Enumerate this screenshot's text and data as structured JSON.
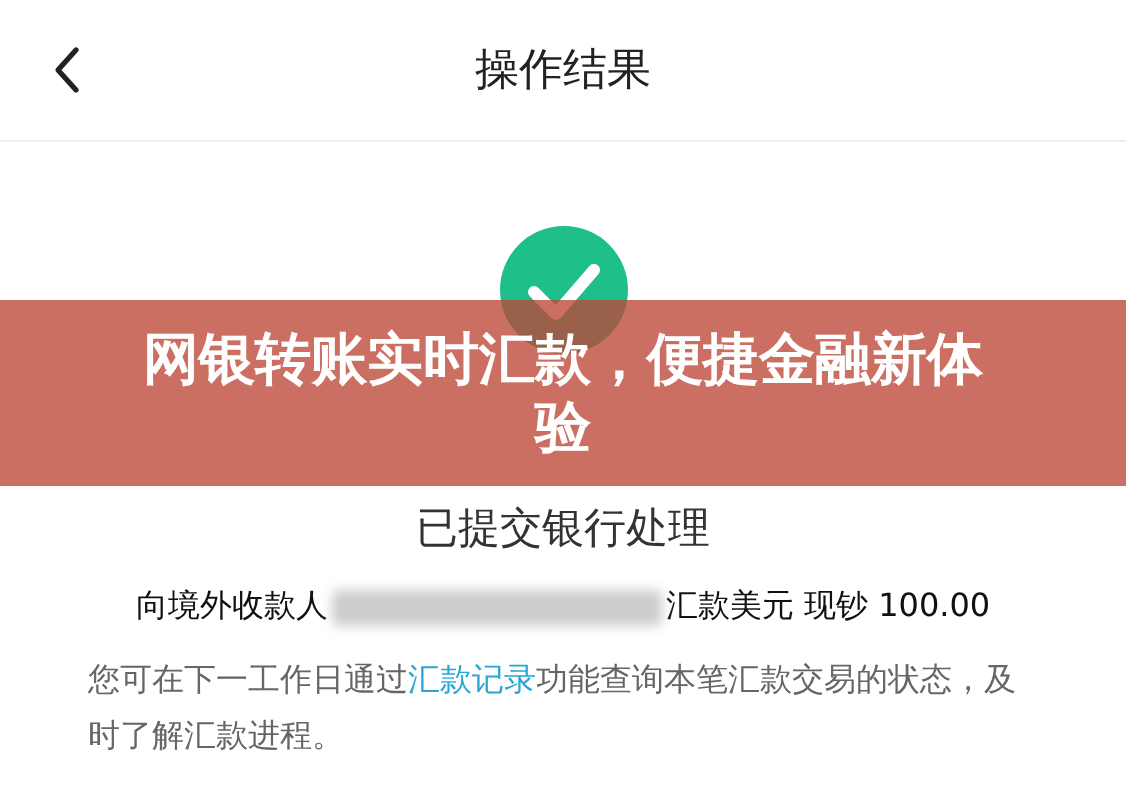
{
  "header": {
    "title": "操作结果"
  },
  "result": {
    "status": "已提交银行处理"
  },
  "summary": {
    "prefix": "向境外收款人",
    "amount": "汇款美元 现钞 100.00"
  },
  "note": {
    "before": "您可在下一工作日通过",
    "link": "汇款记录",
    "after": "功能查询本笔汇款交易的状态，及时了解汇款进程。"
  },
  "banner": {
    "title": "网银转账实时汇款，便捷金融新体验"
  }
}
